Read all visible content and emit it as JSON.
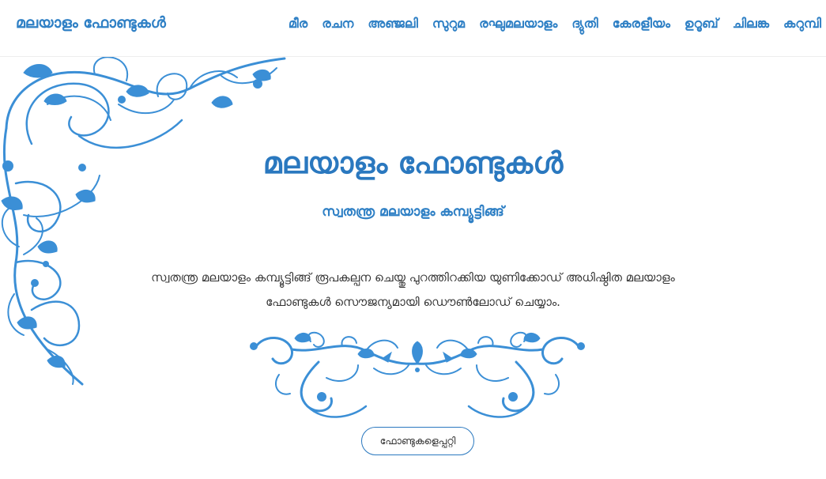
{
  "brand": {
    "name": "മലയാളം ഫോണ്ടുകൾ"
  },
  "nav": {
    "links": [
      "മീര",
      "രചന",
      "അഞ്ജലി",
      "സുറുമ",
      "രഘുമലയാളം",
      "ദ്യുതി",
      "കേരളീയം",
      "ഉറൂബ്",
      "ചിലങ്ക",
      "കറുമ്പി"
    ]
  },
  "hero": {
    "title": "മലയാളം ഫോണ്ടുകൾ",
    "subtitle": "സ്വതന്ത്ര മലയാളം കമ്പ്യൂട്ടിങ്ങ്",
    "description": "സ്വതന്ത്ര മലയാളം കമ്പ്യൂട്ടിങ്ങ് രൂപകല്പന ചെയ്തു പുറത്തിറക്കിയ യുണിക്കോഡ് അധിഷ്ഠിത മലയാളം ഫോണ്ടുകൾ സൌജന്യമായി ഡൌൺലോഡ് ചെയ്യാം.",
    "about_button": "ഫോണ്ടുകളെപ്പറ്റി"
  },
  "colors": {
    "accent": "#2f80c5",
    "ornament": "#3b8fd6",
    "text": "#333333",
    "background": "#ffffff"
  },
  "icons": {
    "corner": "floral-corner-ornament",
    "divider": "floral-divider-ornament"
  }
}
